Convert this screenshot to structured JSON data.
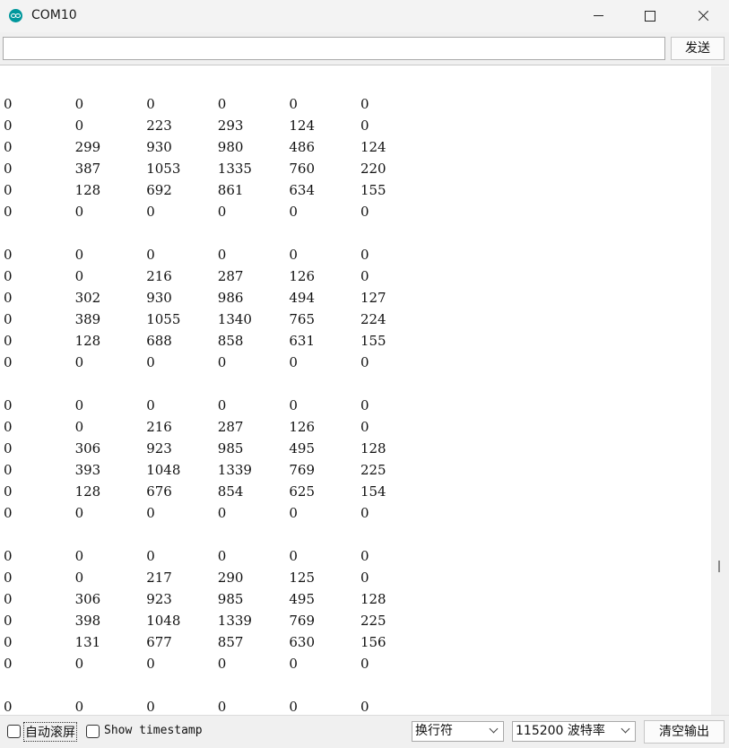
{
  "window": {
    "title": "COM10"
  },
  "toolbar": {
    "input_value": "",
    "send_label": "发送"
  },
  "output": {
    "rows": [
      [
        "0",
        "0",
        "0",
        "0",
        "0",
        "0"
      ],
      [
        "0",
        "0",
        "223",
        "293",
        "124",
        "0"
      ],
      [
        "0",
        "299",
        "930",
        "980",
        "486",
        "124"
      ],
      [
        "0",
        "387",
        "1053",
        "1335",
        "760",
        "220"
      ],
      [
        "0",
        "128",
        "692",
        "861",
        "634",
        "155"
      ],
      [
        "0",
        "0",
        "0",
        "0",
        "0",
        "0"
      ],
      [],
      [
        "0",
        "0",
        "0",
        "0",
        "0",
        "0"
      ],
      [
        "0",
        "0",
        "216",
        "287",
        "126",
        "0"
      ],
      [
        "0",
        "302",
        "930",
        "986",
        "494",
        "127"
      ],
      [
        "0",
        "389",
        "1055",
        "1340",
        "765",
        "224"
      ],
      [
        "0",
        "128",
        "688",
        "858",
        "631",
        "155"
      ],
      [
        "0",
        "0",
        "0",
        "0",
        "0",
        "0"
      ],
      [],
      [
        "0",
        "0",
        "0",
        "0",
        "0",
        "0"
      ],
      [
        "0",
        "0",
        "216",
        "287",
        "126",
        "0"
      ],
      [
        "0",
        "306",
        "923",
        "985",
        "495",
        "128"
      ],
      [
        "0",
        "393",
        "1048",
        "1339",
        "769",
        "225"
      ],
      [
        "0",
        "128",
        "676",
        "854",
        "625",
        "154"
      ],
      [
        "0",
        "0",
        "0",
        "0",
        "0",
        "0"
      ],
      [],
      [
        "0",
        "0",
        "0",
        "0",
        "0",
        "0"
      ],
      [
        "0",
        "0",
        "217",
        "290",
        "125",
        "0"
      ],
      [
        "0",
        "306",
        "923",
        "985",
        "495",
        "128"
      ],
      [
        "0",
        "398",
        "1048",
        "1339",
        "769",
        "225"
      ],
      [
        "0",
        "131",
        "677",
        "857",
        "630",
        "156"
      ],
      [
        "0",
        "0",
        "0",
        "0",
        "0",
        "0"
      ],
      [],
      [
        "0",
        "0",
        "0",
        "0",
        "0",
        "0"
      ]
    ]
  },
  "status": {
    "autoscroll_label": "自动滚屏",
    "autoscroll_checked": false,
    "timestamp_label": "Show timestamp",
    "timestamp_checked": false,
    "line_ending": "换行符",
    "baud_rate": "115200 波特率",
    "clear_label": "清空输出"
  }
}
